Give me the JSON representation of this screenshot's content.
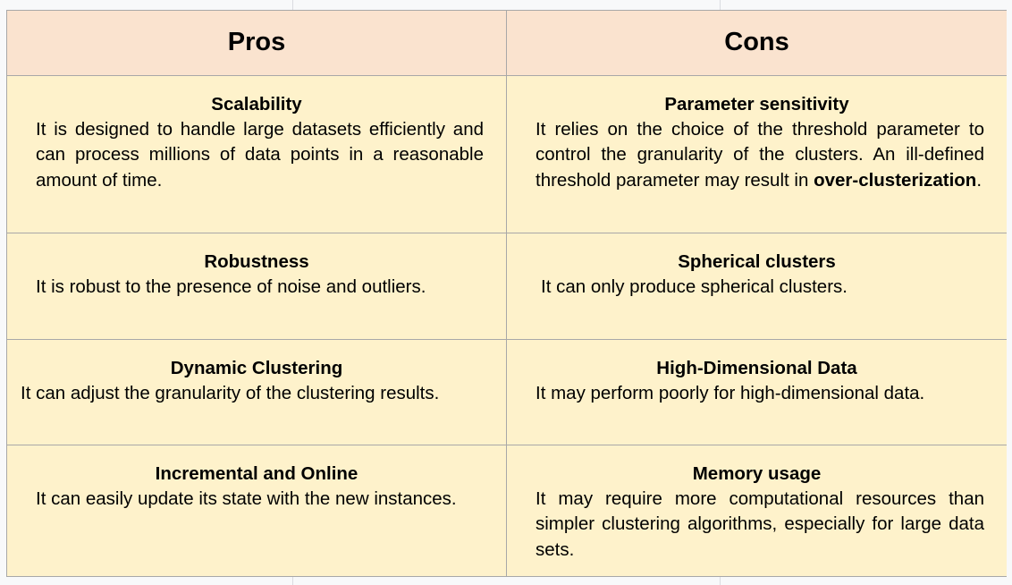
{
  "table": {
    "headers": {
      "pros": "Pros",
      "cons": "Cons"
    },
    "rows": [
      {
        "pro_title": "Scalability",
        "pro_desc": "It is designed to handle large datasets efficiently and can process millions of data points in a reasonable amount of time.",
        "con_title": "Parameter sensitivity",
        "con_desc_before": "It relies on the choice of the threshold parameter to control the granularity of the clusters. An ill-defined threshold parameter may result in ",
        "con_desc_bold": "over-clusterization",
        "con_desc_after": "."
      },
      {
        "pro_title": "Robustness",
        "pro_desc": "It is robust to the presence of noise and outliers.",
        "con_title": "Spherical clusters",
        "con_desc": "It can only produce spherical clusters."
      },
      {
        "pro_title": "Dynamic Clustering",
        "pro_desc": "It can adjust the granularity of the clustering results.",
        "con_title": "High-Dimensional Data",
        "con_desc": "It may perform poorly for high-dimensional data."
      },
      {
        "pro_title": "Incremental and Online",
        "pro_desc": "It can easily update its state with the new instances.",
        "con_title": "Memory usage",
        "con_desc": "It may require more computational resources than simpler clustering algorithms, especially for large data sets."
      }
    ]
  }
}
